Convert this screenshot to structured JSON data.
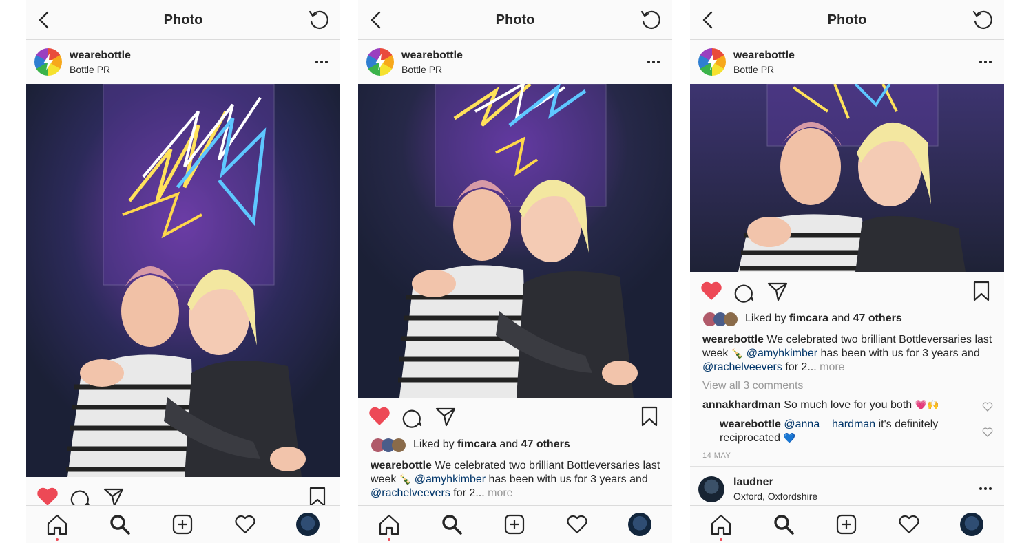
{
  "nav": {
    "title": "Photo"
  },
  "post": {
    "username": "wearebottle",
    "location": "Bottle PR",
    "liked_by_prefix": "Liked by",
    "liked_by_user": "fimcara",
    "liked_by_and": "and",
    "liked_by_others": "47 others",
    "caption_author": "wearebottle",
    "caption_text_1": "We celebrated two brilliant Bottleversaries last week",
    "caption_emoji": "🍾",
    "caption_mention_1": "@amyhkimber",
    "caption_text_2": "has been with us for 3 years and",
    "caption_mention_2": "@rachelveevers",
    "caption_text_3": "for 2...",
    "caption_more": "more",
    "view_comments": "View all 3 comments",
    "comments": [
      {
        "author": "annakhardman",
        "text": "So much love for you both",
        "emoji": "💗🙌"
      }
    ],
    "reply": {
      "author": "wearebottle",
      "mention": "@anna__hardman",
      "text": "it's definitely reciprocated",
      "emoji": "💙"
    },
    "timestamp": "14 MAY"
  },
  "next_post": {
    "username": "laudner",
    "location": "Oxford, Oxfordshire"
  },
  "colors": {
    "like_red": "#ed4956",
    "mention_blue": "#003569",
    "muted_grey": "#999999"
  },
  "icons": {
    "nav": [
      "back-chevron-icon",
      "refresh-icon"
    ],
    "actions": [
      "heart-filled-icon",
      "comment-icon",
      "share-icon",
      "bookmark-icon"
    ],
    "tabs": [
      "home-icon",
      "search-icon",
      "add-icon",
      "heart-outline-icon",
      "profile-avatar"
    ]
  }
}
